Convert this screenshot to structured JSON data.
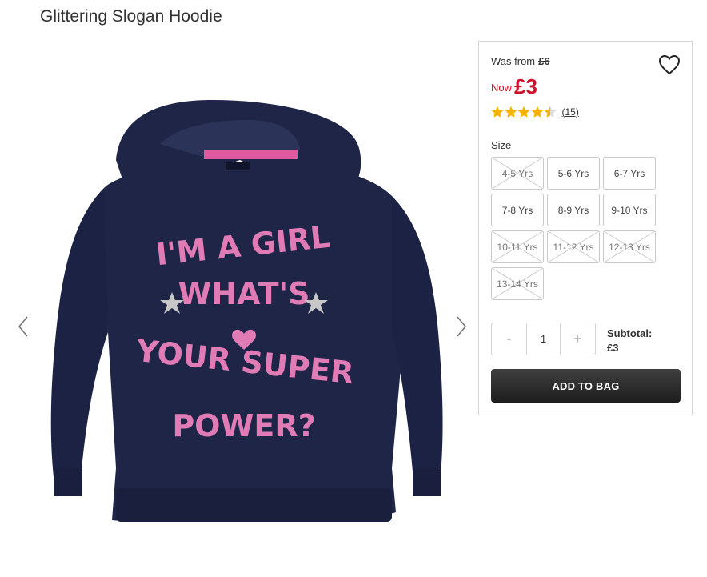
{
  "product": {
    "title": "Glittering Slogan Hoodie",
    "image_alt": "Navy hoodie with pink glitter slogan",
    "slogan": [
      "I'M A GIRL",
      "WHAT'S",
      "YOUR SUPER",
      "POWER?"
    ],
    "brand_tag": "George"
  },
  "price": {
    "was_label": "Was from",
    "was_value": "£6",
    "now_label": "Now",
    "now_value": "£3",
    "accent_color": "#d0112b"
  },
  "rating": {
    "stars": 4.5,
    "max": 5,
    "count_text": "(15)",
    "star_color": "#f5b400"
  },
  "size": {
    "label": "Size",
    "options": [
      {
        "label": "4-5 Yrs",
        "available": false
      },
      {
        "label": "5-6 Yrs",
        "available": true
      },
      {
        "label": "6-7 Yrs",
        "available": true
      },
      {
        "label": "7-8 Yrs",
        "available": true
      },
      {
        "label": "8-9 Yrs",
        "available": true
      },
      {
        "label": "9-10 Yrs",
        "available": true
      },
      {
        "label": "10-11 Yrs",
        "available": false
      },
      {
        "label": "11-12 Yrs",
        "available": false
      },
      {
        "label": "12-13 Yrs",
        "available": false
      },
      {
        "label": "13-14 Yrs",
        "available": false
      }
    ]
  },
  "quantity": {
    "minus": "-",
    "value": "1",
    "plus": "+"
  },
  "subtotal": {
    "label": "Subtotal:",
    "value": "£3"
  },
  "actions": {
    "add_to_bag": "ADD TO BAG"
  },
  "icons": {
    "wishlist": "heart-outline-icon",
    "prev": "chevron-left-icon",
    "next": "chevron-right-icon",
    "star": "star-icon"
  }
}
